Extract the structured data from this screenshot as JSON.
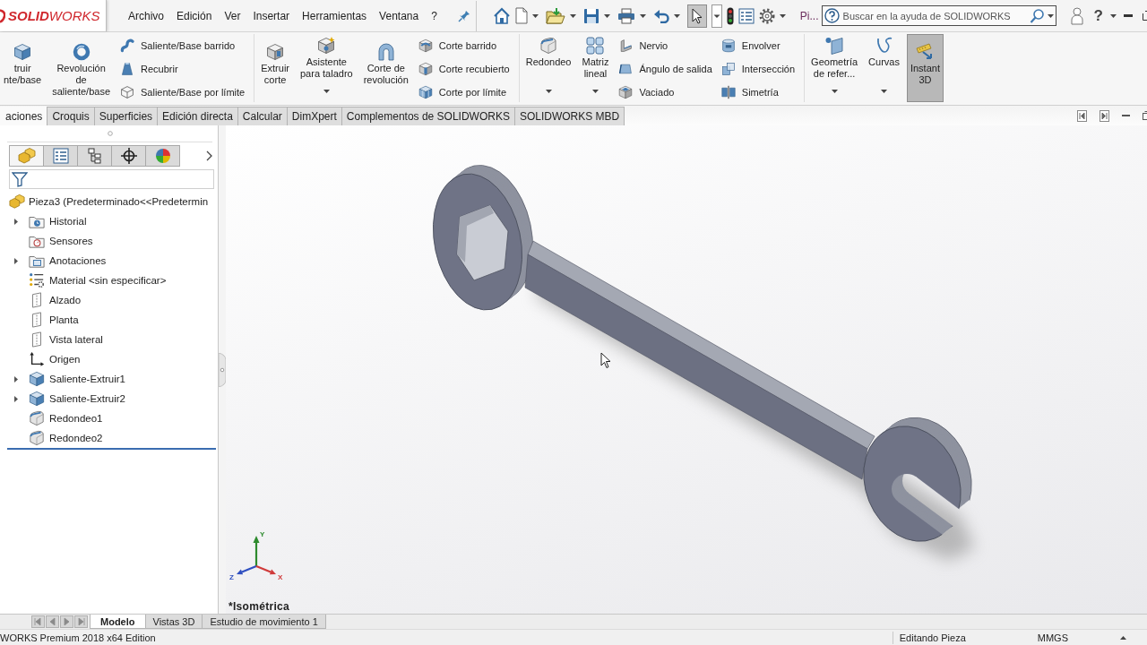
{
  "title_bar": {
    "logo": "**SOLID**WORKS",
    "menu": [
      "Archivo",
      "Edición",
      "Ver",
      "Insertar",
      "Herramientas",
      "Ventana",
      "?"
    ],
    "select_tool": {
      "selected": true
    },
    "document_name": "Pi...",
    "search": {
      "placeholder": "Buscar en la ayuda de SOLIDWORKS"
    },
    "help": "?"
  },
  "ribbon": {
    "groups": [
      {
        "large": [
          {
            "lines": [
              "truir",
              "nte/base"
            ],
            "dropdown": false,
            "pressed": false
          },
          {
            "lines": [
              "Revolución",
              "de",
              "saliente/base"
            ],
            "dropdown": false,
            "pressed": false
          }
        ],
        "columns": [
          [
            "Saliente/Base barrido",
            "Recubrir",
            "Saliente/Base por límite"
          ]
        ]
      },
      {
        "large": [
          {
            "lines": [
              "Extruir",
              "corte"
            ],
            "dropdown": false,
            "pressed": false
          },
          {
            "lines": [
              "Asistente",
              "para taladro"
            ],
            "dropdown": true,
            "pressed": false
          },
          {
            "lines": [
              "Corte de",
              "revolución"
            ],
            "dropdown": false,
            "pressed": false
          }
        ],
        "columns": [
          [
            "Corte barrido",
            "Corte recubierto",
            "Corte por límite"
          ]
        ]
      },
      {
        "large": [
          {
            "lines": [
              "Redondeo"
            ],
            "dropdown": true,
            "pressed": false
          },
          {
            "lines": [
              "Matriz",
              "lineal"
            ],
            "dropdown": true,
            "pressed": false
          }
        ],
        "columns": [
          [
            "Nervio",
            "Ángulo de salida",
            "Vaciado"
          ],
          [
            "Envolver",
            "Intersección",
            "Simetría"
          ]
        ]
      },
      {
        "large": [
          {
            "lines": [
              "Geometría",
              "de refer..."
            ],
            "dropdown": true,
            "pressed": false
          },
          {
            "lines": [
              "Curvas"
            ],
            "dropdown": true,
            "pressed": false
          },
          {
            "lines": [
              "Instant",
              "3D"
            ],
            "dropdown": false,
            "pressed": true
          }
        ]
      }
    ],
    "tabs": [
      {
        "label": "aciones",
        "selected": true
      },
      {
        "label": "Croquis",
        "selected": false
      },
      {
        "label": "Superficies",
        "selected": false
      },
      {
        "label": "Edición directa",
        "selected": false
      },
      {
        "label": "Calcular",
        "selected": false
      },
      {
        "label": "DimXpert",
        "selected": false
      },
      {
        "label": "Complementos de SOLIDWORKS",
        "selected": false
      },
      {
        "label": "SOLIDWORKS MBD",
        "selected": false
      }
    ]
  },
  "feature_manager": {
    "tabs": [
      {
        "selected": true
      },
      {
        "selected": false
      },
      {
        "selected": false
      },
      {
        "selected": false
      },
      {
        "selected": false
      }
    ],
    "tree": {
      "label": "Pieza3 (Predeterminado<<Predetermin",
      "children": [
        {
          "label": "Historial",
          "kind": "history",
          "expandable": true
        },
        {
          "label": "Sensores",
          "kind": "sensors",
          "expandable": false
        },
        {
          "label": "Anotaciones",
          "kind": "annotations",
          "expandable": true
        },
        {
          "label": "Material <sin especificar>",
          "kind": "material",
          "expandable": false
        },
        {
          "label": "Alzado",
          "kind": "plane",
          "expandable": false
        },
        {
          "label": "Planta",
          "kind": "plane",
          "expandable": false
        },
        {
          "label": "Vista lateral",
          "kind": "plane",
          "expandable": false
        },
        {
          "label": "Origen",
          "kind": "origin",
          "expandable": false
        },
        {
          "label": "Saliente-Extruir1",
          "kind": "extrude",
          "expandable": true
        },
        {
          "label": "Saliente-Extruir2",
          "kind": "extrude",
          "expandable": true
        },
        {
          "label": "Redondeo1",
          "kind": "fillet",
          "expandable": false
        },
        {
          "label": "Redondeo2",
          "kind": "fillet",
          "expandable": false
        }
      ]
    }
  },
  "viewport": {
    "triad": [
      "Y",
      "Z",
      "X"
    ],
    "view_name": "*Isométrica"
  },
  "bottom_tabs": [
    {
      "label": "Modelo",
      "selected": true
    },
    {
      "label": "Vistas 3D",
      "selected": false
    },
    {
      "label": "Estudio de movimiento 1",
      "selected": false
    }
  ],
  "status_bar": {
    "product": "WORKS Premium 2018 x64 Edition",
    "mode": "Editando Pieza",
    "units": "MMGS"
  }
}
